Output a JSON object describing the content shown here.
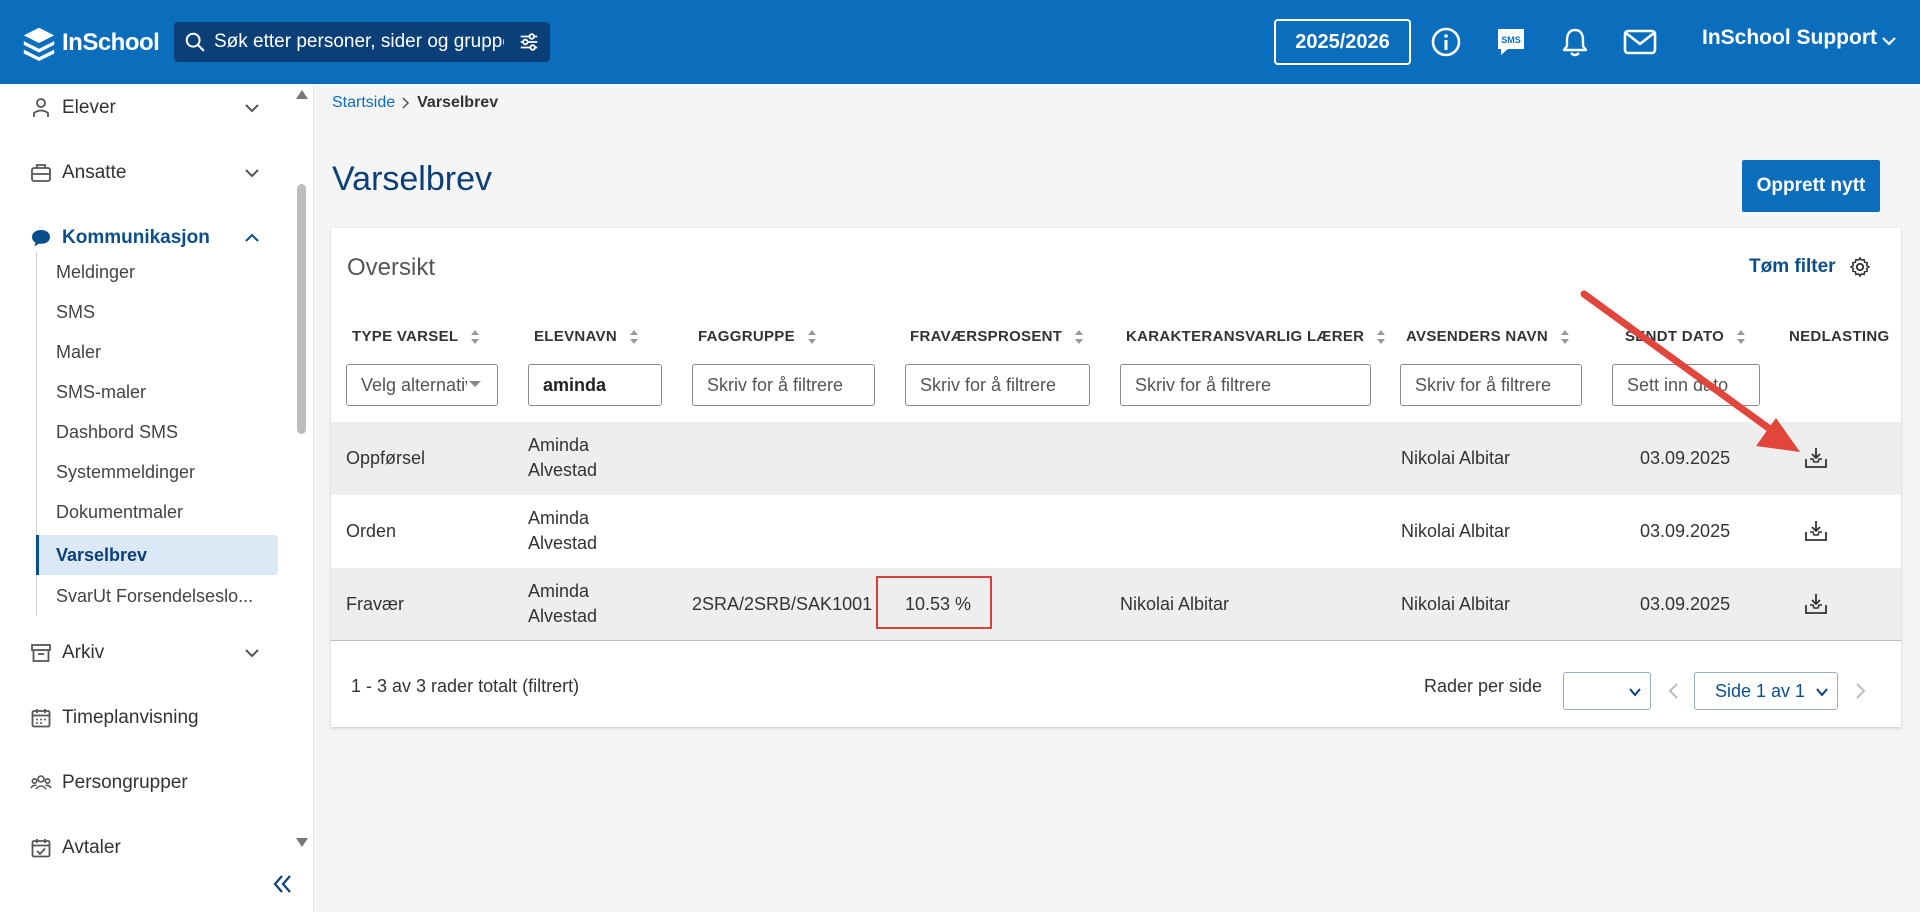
{
  "header": {
    "logo_text": "InSchool",
    "search_placeholder": "Søk etter personer, sider og grupper",
    "year": "2025/2026",
    "user_name": "InSchool Support",
    "brand_color": "#0a6ebd",
    "icons": [
      "filter-icon",
      "info-icon",
      "sms-icon",
      "bell-icon",
      "mail-icon",
      "chevron-down-icon"
    ]
  },
  "sidebar": {
    "items": [
      {
        "label": "Elever",
        "icon": "student-icon",
        "expanded": false
      },
      {
        "label": "Ansatte",
        "icon": "briefcase-icon",
        "expanded": false
      },
      {
        "label": "Kommunikasjon",
        "icon": "chat-icon",
        "expanded": true
      },
      {
        "label": "Arkiv",
        "icon": "archive-icon",
        "expanded": false
      },
      {
        "label": "Timeplanvisning",
        "icon": "calendar-icon"
      },
      {
        "label": "Persongrupper",
        "icon": "group-icon"
      },
      {
        "label": "Avtaler",
        "icon": "calendar-check-icon"
      }
    ],
    "sub_items": [
      {
        "label": "Meldinger"
      },
      {
        "label": "SMS"
      },
      {
        "label": "Maler"
      },
      {
        "label": "SMS-maler"
      },
      {
        "label": "Dashbord SMS"
      },
      {
        "label": "Systemmeldinger"
      },
      {
        "label": "Dokumentmaler"
      },
      {
        "label": "Varselbrev",
        "active": true
      },
      {
        "label": "SvarUt Forsendelseslo..."
      }
    ]
  },
  "breadcrumb": {
    "home": "Startside",
    "current": "Varselbrev"
  },
  "page": {
    "title": "Varselbrev",
    "create_button": "Opprett nytt"
  },
  "overview": {
    "title": "Oversikt",
    "clear_filter": "Tøm filter",
    "columns": [
      {
        "label": "TYPE VARSEL",
        "sortable": true
      },
      {
        "label": "ELEVNAVN",
        "sortable": true
      },
      {
        "label": "FAGGRUPPE",
        "sortable": true
      },
      {
        "label": "FRAVÆRSPROSENT",
        "sortable": true
      },
      {
        "label": "KARAKTERANSVARLIG LÆRER",
        "sortable": true
      },
      {
        "label": "AVSENDERS NAVN",
        "sortable": true
      },
      {
        "label": "SENDT DATO",
        "sortable": true
      },
      {
        "label": "NEDLASTING",
        "sortable": false
      }
    ],
    "filters": {
      "type_placeholder": "Velg alternativ",
      "elevnavn_value": "aminda",
      "text_placeholder": "Skriv for å filtrere",
      "date_placeholder": "Sett inn dato"
    },
    "rows": [
      {
        "type": "Oppførsel",
        "first": "Aminda",
        "last": "Alvestad",
        "faggruppe": "",
        "fravaer": "",
        "laerer": "",
        "avsender": "Nikolai Albitar",
        "dato": "03.09.2025"
      },
      {
        "type": "Orden",
        "first": "Aminda",
        "last": "Alvestad",
        "faggruppe": "",
        "fravaer": "",
        "laerer": "",
        "avsender": "Nikolai Albitar",
        "dato": "03.09.2025"
      },
      {
        "type": "Fravær",
        "first": "Aminda",
        "last": "Alvestad",
        "faggruppe": "2SRA/2SRB/SAK1001",
        "fravaer": "10.53 %",
        "laerer": "Nikolai Albitar",
        "avsender": "Nikolai Albitar",
        "dato": "03.09.2025"
      }
    ],
    "footer": {
      "count_text": "1 - 3 av 3 rader totalt (filtrert)",
      "rows_per_page_label": "Rader per side",
      "page_text": "Side 1 av 1"
    }
  },
  "annotation_color": "#e0463b"
}
